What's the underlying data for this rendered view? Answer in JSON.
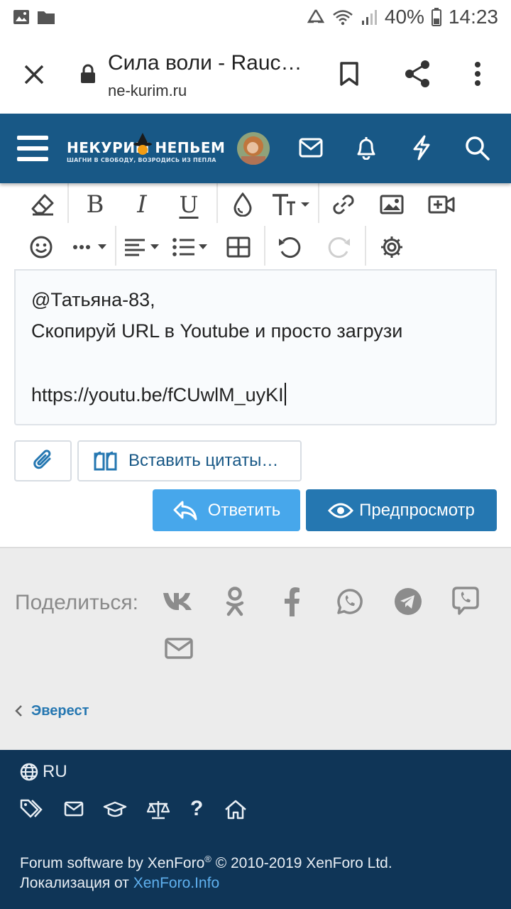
{
  "status_bar": {
    "battery_percent": "40%",
    "time": "14:23"
  },
  "browser": {
    "page_title": "Сила воли - Rauc…",
    "url": "ne-kurim.ru"
  },
  "forum_header": {
    "logo_text": "НЕКУРИМ НЕПЬЕМ",
    "logo_tagline": "ШАГНИ В СВОБОДУ, ВОЗРОДИСЬ ИЗ ПЕПЛА",
    "icons": [
      "menu-icon",
      "avatar",
      "mail-icon",
      "bell-icon",
      "lightning-icon",
      "search-icon"
    ]
  },
  "editor": {
    "lines": [
      "@Татьяна-83,",
      "Скопируй URL в Youtube и просто загрузи",
      "",
      "https://youtu.be/fCUwlM_uyKI"
    ],
    "toolbar_row1": [
      "eraser-icon",
      "bold-icon",
      "italic-icon",
      "underline-icon",
      "color-drop-icon",
      "text-size-icon",
      "link-icon",
      "image-icon",
      "video-icon"
    ],
    "toolbar_row2": [
      "smiley-icon",
      "more-icon",
      "align-icon",
      "list-icon",
      "table-icon",
      "undo-icon",
      "redo-icon",
      "settings-icon"
    ]
  },
  "buttons": {
    "insert_quotes": "Вставить цитаты…",
    "reply": "Ответить",
    "preview": "Предпросмотр"
  },
  "share": {
    "label": "Поделиться:",
    "networks": [
      "vk-icon",
      "odnoklassniki-icon",
      "facebook-icon",
      "whatsapp-icon",
      "telegram-icon",
      "viber-icon",
      "email-icon"
    ]
  },
  "breadcrumb": {
    "back_label": "Эверест"
  },
  "footer": {
    "language": "RU",
    "credit_line1": "Forum software by XenForo",
    "credit_reg": "®",
    "credit_line1_rest": " © 2010-2019 XenForo Ltd.",
    "localization_prefix": "Локализация от ",
    "localization_link": "XenForo.Info"
  },
  "colors": {
    "header_bg": "#185886",
    "footer_bg": "#0f3557",
    "reply_button": "#47a7eb",
    "preview_button": "#2577b1",
    "link": "#2577b1"
  }
}
